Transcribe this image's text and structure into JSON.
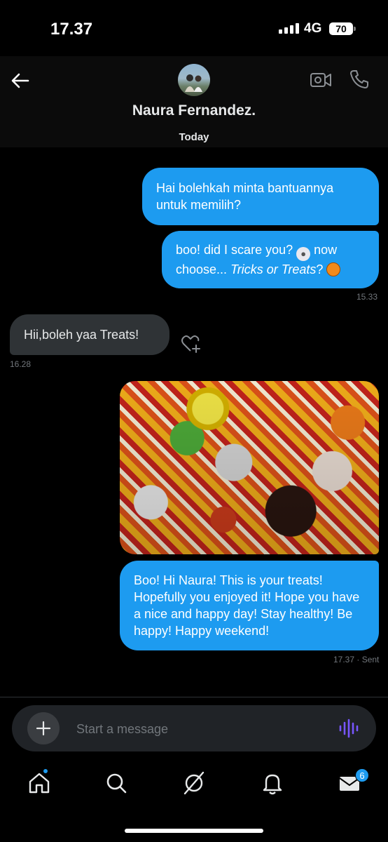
{
  "status_bar": {
    "time": "17.37",
    "network": "4G",
    "battery": "70"
  },
  "header": {
    "contact_name": "Naura Fernandez."
  },
  "day_label": "Today",
  "messages": {
    "m1": {
      "text": "Hai bolehkah minta bantuannya untuk memilih?"
    },
    "m2": {
      "text_a": "boo! did I scare you?",
      "text_b": "now choose...",
      "text_italic": "Tricks or Treats",
      "text_c": "?",
      "time": "15.33"
    },
    "m3": {
      "text": "Hii,boleh yaa Treats!",
      "time": "16.28"
    },
    "m5": {
      "text": "Boo! Hi Naura! This is your treats! Hopefully you enjoyed it! Hope you have a nice and happy day! Stay healthy! Be happy! Happy weekend!",
      "time": "17.37 · Sent"
    }
  },
  "composer": {
    "placeholder": "Start a message"
  },
  "tabbar": {
    "messages_badge": "6"
  },
  "colors": {
    "accent": "#1d9bf0",
    "received_bubble": "#2f3336",
    "background": "#000000",
    "voice_icon": "#7856ff"
  }
}
